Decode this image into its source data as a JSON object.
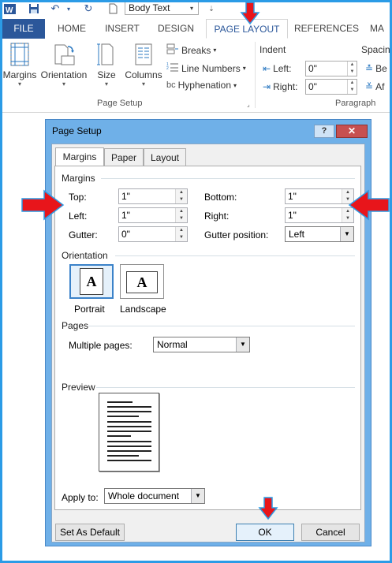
{
  "quick_access": {
    "style_value": "Body Text"
  },
  "tabs": [
    {
      "label": "FILE"
    },
    {
      "label": "HOME"
    },
    {
      "label": "INSERT"
    },
    {
      "label": "DESIGN"
    },
    {
      "label": "PAGE LAYOUT"
    },
    {
      "label": "REFERENCES"
    },
    {
      "label": "MA"
    }
  ],
  "ribbon": {
    "page_setup": {
      "margins": "Margins",
      "orientation": "Orientation",
      "size": "Size",
      "columns": "Columns",
      "breaks": "Breaks",
      "line_numbers": "Line Numbers",
      "hyphenation": "Hyphenation",
      "group_label": "Page Setup"
    },
    "paragraph": {
      "indent_label": "Indent",
      "left_label": "Left:",
      "left_value": "0\"",
      "right_label": "Right:",
      "right_value": "0\"",
      "spacing_label": "Spacin",
      "before_label": "Be",
      "after_label": "Af",
      "group_label": "Paragraph"
    }
  },
  "dialog": {
    "title": "Page Setup",
    "help": "?",
    "close": "✕",
    "tabs": [
      "Margins",
      "Paper",
      "Layout"
    ],
    "margins_section": "Margins",
    "top_label": "Top:",
    "top_value": "1\"",
    "bottom_label": "Bottom:",
    "bottom_value": "1\"",
    "left_label": "Left:",
    "left_value": "1\"",
    "right_label": "Right:",
    "right_value": "1\"",
    "gutter_label": "Gutter:",
    "gutter_value": "0\"",
    "gutter_pos_label": "Gutter position:",
    "gutter_pos_value": "Left",
    "orientation_section": "Orientation",
    "portrait": "Portrait",
    "landscape": "Landscape",
    "orient_glyph": "A",
    "pages_section": "Pages",
    "multiple_pages_label": "Multiple pages:",
    "multiple_pages_value": "Normal",
    "preview_section": "Preview",
    "apply_to_label": "Apply to:",
    "apply_to_value": "Whole document",
    "set_default": "Set As Default",
    "ok": "OK",
    "cancel": "Cancel"
  },
  "colors": {
    "accent": "#2b579a",
    "annotation_arrow": "#e8151b",
    "annotation_outline": "#2b9be6"
  }
}
